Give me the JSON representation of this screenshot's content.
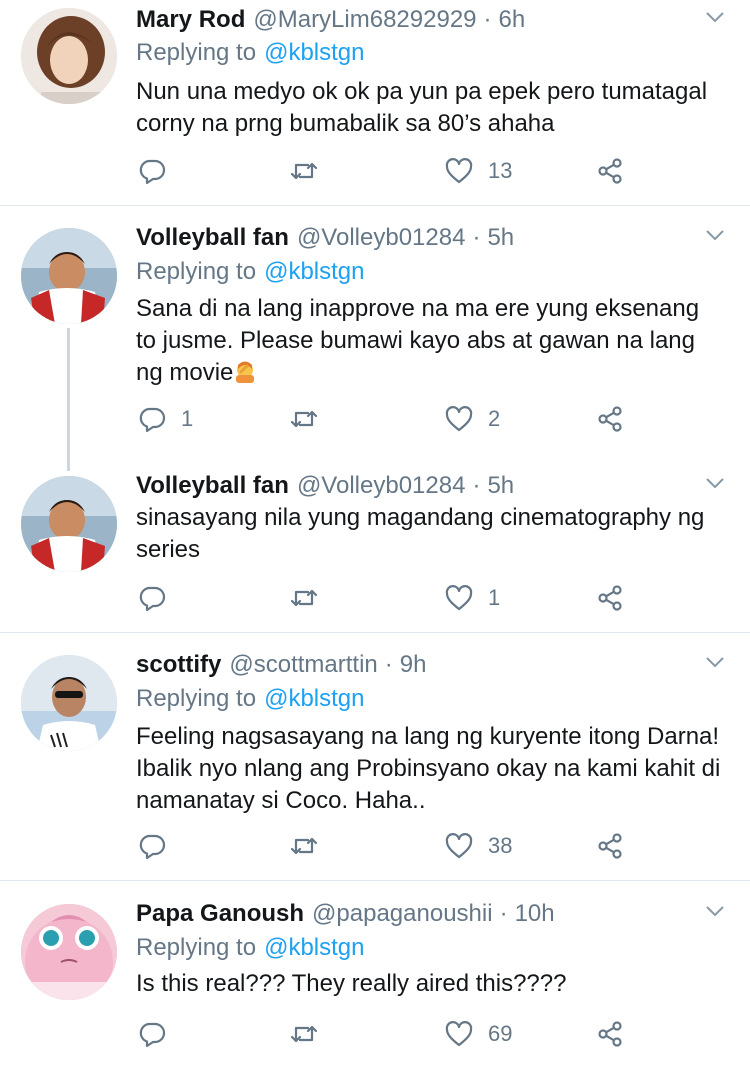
{
  "tweets": [
    {
      "name": "Mary Rod",
      "handle": "@MaryLim68292929",
      "time": "6h",
      "replying_prefix": "Replying to",
      "replying_to": "@kblstgn",
      "lines": [
        "Nun una medyo ok ok pa yun pa epek pero tumatagal",
        "corny na prng bumabalik sa 80’s ahaha"
      ],
      "reply_count": "",
      "retweet_count": "",
      "like_count": "13"
    },
    {
      "name": "Volleyball fan",
      "handle": "@Volleyb01284",
      "time": "5h",
      "replying_prefix": "Replying to",
      "replying_to": "@kblstgn",
      "lines": [
        "Sana di na lang inapprove na ma ere yung eksenang",
        "to jusme. Please bumawi kayo abs at gawan na lang",
        "ng movie"
      ],
      "emoji": "facepalm-emoji",
      "reply_count": "1",
      "retweet_count": "",
      "like_count": "2"
    },
    {
      "name": "Volleyball fan",
      "handle": "@Volleyb01284",
      "time": "5h",
      "lines": [
        "sinasayang nila yung magandang cinematography ng",
        "series"
      ],
      "reply_count": "",
      "retweet_count": "",
      "like_count": "1"
    },
    {
      "name": "scottify",
      "handle": "@scottmarttin",
      "time": "9h",
      "replying_prefix": "Replying to",
      "replying_to": "@kblstgn",
      "lines": [
        "Feeling nagsasayang na lang ng kuryente itong Darna!",
        "Ibalik nyo nlang ang Probinsyano okay na kami kahit di",
        "namanatay si Coco. Haha.."
      ],
      "reply_count": "",
      "retweet_count": "",
      "like_count": "38"
    },
    {
      "name": "Papa Ganoush",
      "handle": "@papaganoushii",
      "time": "10h",
      "replying_prefix": "Replying to",
      "replying_to": "@kblstgn",
      "lines": [
        "Is this real??? They really aired this????"
      ],
      "reply_count": "",
      "retweet_count": "",
      "like_count": "69"
    }
  ],
  "icons": {
    "reply": "reply-icon",
    "retweet": "retweet-icon",
    "like": "heart-icon",
    "share": "share-icon",
    "caret": "chevron-down-icon"
  },
  "colors": {
    "text": "#14171a",
    "secondary": "#657786",
    "link": "#1da1f2",
    "divider": "#e1e8ed",
    "thread_line": "#ccd6dd"
  }
}
